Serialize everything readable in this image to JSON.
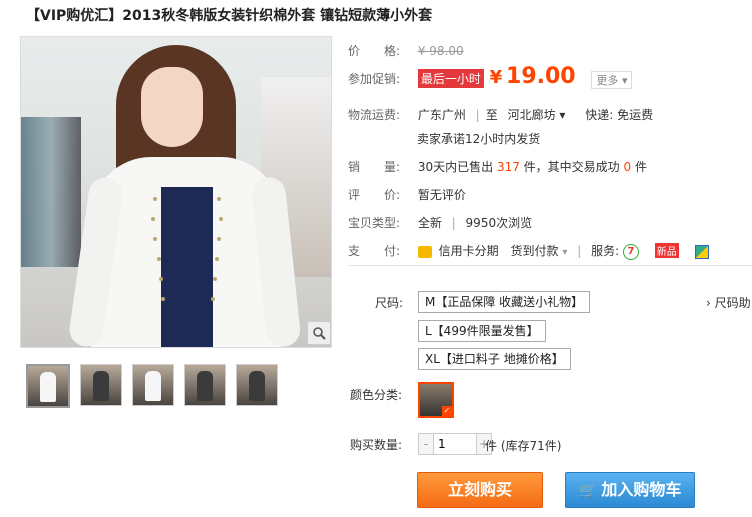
{
  "title": "【VIP购优汇】2013秋冬韩版女装针织棉外套 镶钻短款薄小外套",
  "price": {
    "label": "价　　格:",
    "value": "¥ 98.00"
  },
  "promo": {
    "label": "参加促销:",
    "tag": "最后一小时",
    "yen": "¥",
    "value": "19.00",
    "more": "更多"
  },
  "shipping": {
    "label": "物流运费:",
    "from": "广东广州",
    "sep": "至",
    "to": "河北廊坊",
    "express": "快递: 免运费",
    "promise": "卖家承诺12小时内发货"
  },
  "sales": {
    "label": "销　　量:",
    "prefix": "30天内已售出",
    "count": "317",
    "mid": "件，其中交易成功",
    "success": "0",
    "suffix": "件"
  },
  "rating": {
    "label": "评　　价:",
    "value": "暂无评价"
  },
  "type": {
    "label": "宝贝类型:",
    "condition": "全新",
    "views": "9950次浏览"
  },
  "payment": {
    "label": "支　　付:",
    "credit": "信用卡分期",
    "cod": "货到付款",
    "service_label": "服务:",
    "new_tag": "新品",
    "credit_icon": "credit-card-icon",
    "service_icon": "seven-day-return-icon"
  },
  "size": {
    "label": "尺码:",
    "options": [
      "M【正品保障 收藏送小礼物】",
      "L【499件限量发售】",
      "XL【进口料子 地摊价格】"
    ],
    "guide": "› 尺码助"
  },
  "color": {
    "label": "颜色分类:"
  },
  "quantity": {
    "label": "购买数量:",
    "value": "1",
    "minus": "-",
    "plus": "+",
    "stock": "件 (库存71件)"
  },
  "buttons": {
    "buy_now": "立刻购买",
    "add_cart": "加入购物车"
  },
  "colors": {
    "accent": "#ff4400",
    "cart_blue": "#2a8ad4"
  }
}
